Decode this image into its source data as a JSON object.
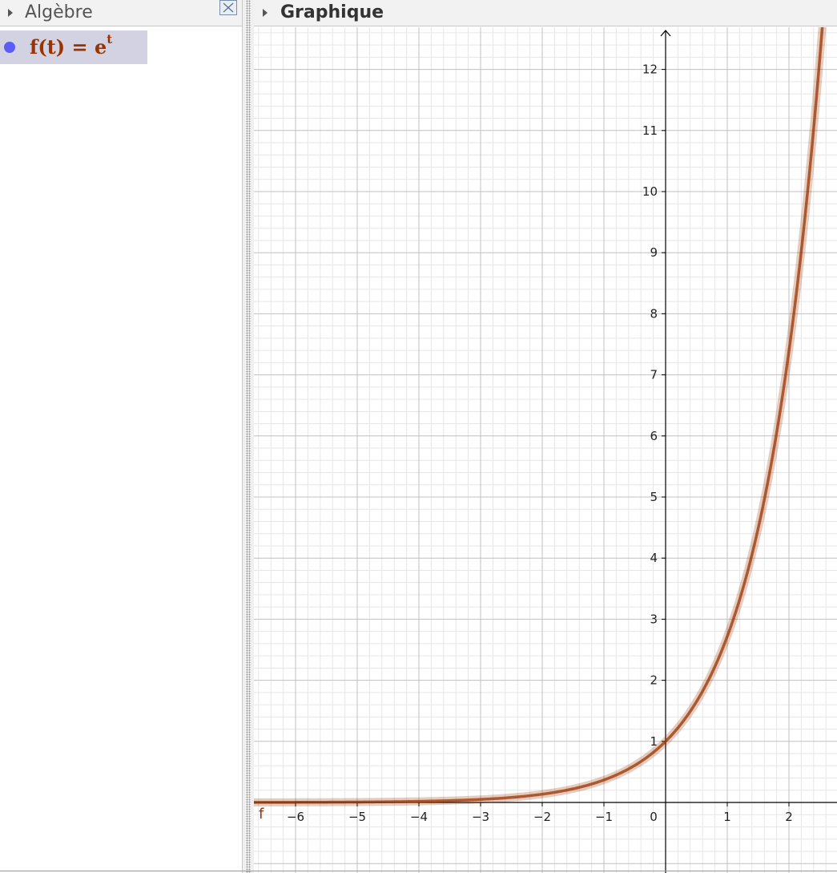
{
  "algebra_panel": {
    "title": "Algèbre",
    "objects": [
      {
        "name": "f",
        "lhs": "f(t)",
        "equals": "=",
        "base": "e",
        "exponent": "t",
        "color": "#993300",
        "dot_color": "#5c5cf6"
      }
    ]
  },
  "graphics_panel": {
    "title": "Graphique"
  },
  "chart_data": {
    "type": "line",
    "function_label": "f",
    "function": "e^t",
    "series": [
      {
        "name": "f",
        "color": "#993300",
        "x": [
          -6.8,
          -6,
          -5,
          -4,
          -3,
          -2.5,
          -2,
          -1.5,
          -1,
          -0.5,
          0,
          0.5,
          1,
          1.25,
          1.5,
          1.75,
          2,
          2.25,
          2.5,
          2.54
        ],
        "y": [
          0.0011,
          0.0025,
          0.0067,
          0.0183,
          0.0498,
          0.0821,
          0.1353,
          0.2231,
          0.3679,
          0.6065,
          1,
          1.6487,
          2.7183,
          3.4903,
          4.4817,
          5.7546,
          7.3891,
          9.4877,
          12.1825,
          12.68
        ]
      }
    ],
    "xlim": [
      -6.8,
      2.8
    ],
    "ylim": [
      -1.1,
      12.7
    ],
    "x_ticks": [
      "-6",
      "-5",
      "-4",
      "-3",
      "-2",
      "-1",
      "0",
      "1",
      "2"
    ],
    "y_ticks": [
      "1",
      "2",
      "3",
      "4",
      "5",
      "6",
      "7",
      "8",
      "9",
      "10",
      "11",
      "12"
    ],
    "grid": true,
    "minor_grid": true,
    "axis_color": "#000000",
    "grid_color": "#c0c0c0",
    "minor_grid_color": "#e6e6e6"
  }
}
